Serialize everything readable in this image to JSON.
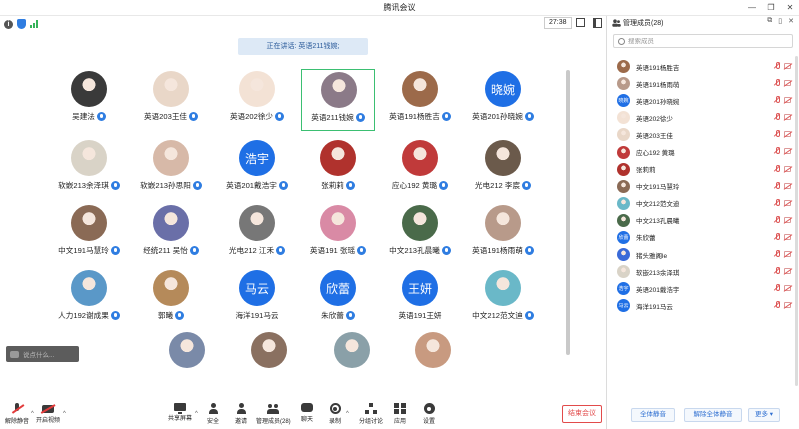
{
  "window": {
    "title": "腾讯会议"
  },
  "status": {
    "time": "27:38"
  },
  "banner": {
    "speaking": "正在讲话: 英语211钱婉;"
  },
  "colors": {
    "accent": "#1f6fe5",
    "selected": "#3bbf72",
    "danger": "#e24b4b"
  },
  "participants": [
    {
      "name": "吴建法",
      "avatar": "photo",
      "photo_color": "#3a3a3a",
      "mic": true
    },
    {
      "name": "英语203王佳",
      "avatar": "photo",
      "photo_color": "#e9d7c8",
      "mic": true
    },
    {
      "name": "英语202徐少",
      "avatar": "photo",
      "photo_color": "#f3e2d5",
      "mic": true
    },
    {
      "name": "英语211钱婉",
      "avatar": "photo",
      "photo_color": "#8b7a88",
      "mic": true,
      "selected": true
    },
    {
      "name": "英语191杨胜吉",
      "avatar": "photo",
      "photo_color": "#9c6a4a",
      "mic": true
    },
    {
      "name": "英语201孙晓婉",
      "avatar": "text",
      "text": "晓婉",
      "mic": true
    },
    {
      "name": "软嵌213余泽琪",
      "avatar": "photo",
      "photo_color": "#d9d3c7",
      "mic": true
    },
    {
      "name": "软嵌213孙思阳",
      "avatar": "photo",
      "photo_color": "#d7b9a8",
      "mic": true
    },
    {
      "name": "英语201戴浩宇",
      "avatar": "text",
      "text": "浩宇",
      "mic": true
    },
    {
      "name": "张莉莉",
      "avatar": "photo",
      "photo_color": "#b0322d",
      "mic": true
    },
    {
      "name": "应心192 黄璐",
      "avatar": "photo",
      "photo_color": "#c03a3a",
      "mic": true
    },
    {
      "name": "光电212 李宸",
      "avatar": "photo",
      "photo_color": "#6b5a4b",
      "mic": true
    },
    {
      "name": "中文191马慧玲",
      "avatar": "photo",
      "photo_color": "#8a6a55",
      "mic": true
    },
    {
      "name": "经统211 吴怡",
      "avatar": "photo",
      "photo_color": "#6a6fa8",
      "mic": true
    },
    {
      "name": "光电212 江禾",
      "avatar": "photo",
      "photo_color": "#777777",
      "mic": true
    },
    {
      "name": "英语191 张瑶",
      "avatar": "photo",
      "photo_color": "#d98aa5",
      "mic": true
    },
    {
      "name": "中文213孔晨曦",
      "avatar": "photo",
      "photo_color": "#4a6a4a",
      "mic": true
    },
    {
      "name": "英语191杨雨萌",
      "avatar": "photo",
      "photo_color": "#b89a8a",
      "mic": true
    },
    {
      "name": "人力192谢成果",
      "avatar": "photo",
      "photo_color": "#5a98c8",
      "mic": true
    },
    {
      "name": "郭曦",
      "avatar": "photo",
      "photo_color": "#b58a5a",
      "mic": true
    },
    {
      "name": "海洋191马云",
      "avatar": "text",
      "text": "马云",
      "mic": false
    },
    {
      "name": "朱欣蕾",
      "avatar": "text",
      "text": "欣蕾",
      "mic": true
    },
    {
      "name": "英语191王妍",
      "avatar": "text",
      "text": "王妍",
      "mic": false
    },
    {
      "name": "中文212范文迪",
      "avatar": "photo",
      "photo_color": "#6ab8c8",
      "mic": true
    },
    {
      "name": "",
      "avatar": "photo",
      "photo_color": "#7a8aa8",
      "mic": false
    },
    {
      "name": "",
      "avatar": "photo",
      "photo_color": "#8a7060",
      "mic": false
    },
    {
      "name": "",
      "avatar": "photo",
      "photo_color": "#8aa0a8",
      "mic": false
    },
    {
      "name": "",
      "avatar": "photo",
      "photo_color": "#c89a80",
      "mic": false
    }
  ],
  "chat": {
    "placeholder": "说点什么..."
  },
  "toolbar": {
    "mute": "解除静音",
    "video": "开启视频",
    "share": "共享屏幕",
    "security": "安全",
    "invite": "邀请",
    "members": "管理成员(28)",
    "chat": "聊天",
    "record": "录制",
    "breakout": "分组讨论",
    "apps": "应用",
    "settings": "设置",
    "end": "结束会议"
  },
  "panel": {
    "title": "管理成员(28)",
    "search_placeholder": "搜索成员",
    "members": [
      {
        "name": "英语191杨胜吉",
        "avatar": "photo",
        "photo_color": "#9c6a4a"
      },
      {
        "name": "英语191杨雨萌",
        "avatar": "photo",
        "photo_color": "#b89a8a"
      },
      {
        "name": "英语201孙晓婉",
        "avatar": "text",
        "text": "晓婉"
      },
      {
        "name": "英语202徐少",
        "avatar": "photo",
        "photo_color": "#f3e2d5"
      },
      {
        "name": "英语203王佳",
        "avatar": "photo",
        "photo_color": "#e9d7c8"
      },
      {
        "name": "应心192 黄璐",
        "avatar": "photo",
        "photo_color": "#c03a3a"
      },
      {
        "name": "张莉莉",
        "avatar": "photo",
        "photo_color": "#b0322d"
      },
      {
        "name": "中文191马慧玲",
        "avatar": "photo",
        "photo_color": "#8a6a55"
      },
      {
        "name": "中文212范文迪",
        "avatar": "photo",
        "photo_color": "#6ab8c8"
      },
      {
        "name": "中文213孔晨曦",
        "avatar": "photo",
        "photo_color": "#4a6a4a"
      },
      {
        "name": "朱欣蕾",
        "avatar": "text",
        "text": "欣蕾"
      },
      {
        "name": "猪头雅阁le",
        "avatar": "photo",
        "photo_color": "#3a6ad8"
      },
      {
        "name": "软嵌213余泽琪",
        "avatar": "photo",
        "photo_color": "#d9d3c7"
      },
      {
        "name": "英语201戴浩宇",
        "avatar": "text",
        "text": "浩宇"
      },
      {
        "name": "海洋191马云",
        "avatar": "text",
        "text": "马云"
      }
    ],
    "mute_all": "全体静音",
    "unmute_all": "解除全体静音",
    "more": "更多 ▾"
  }
}
